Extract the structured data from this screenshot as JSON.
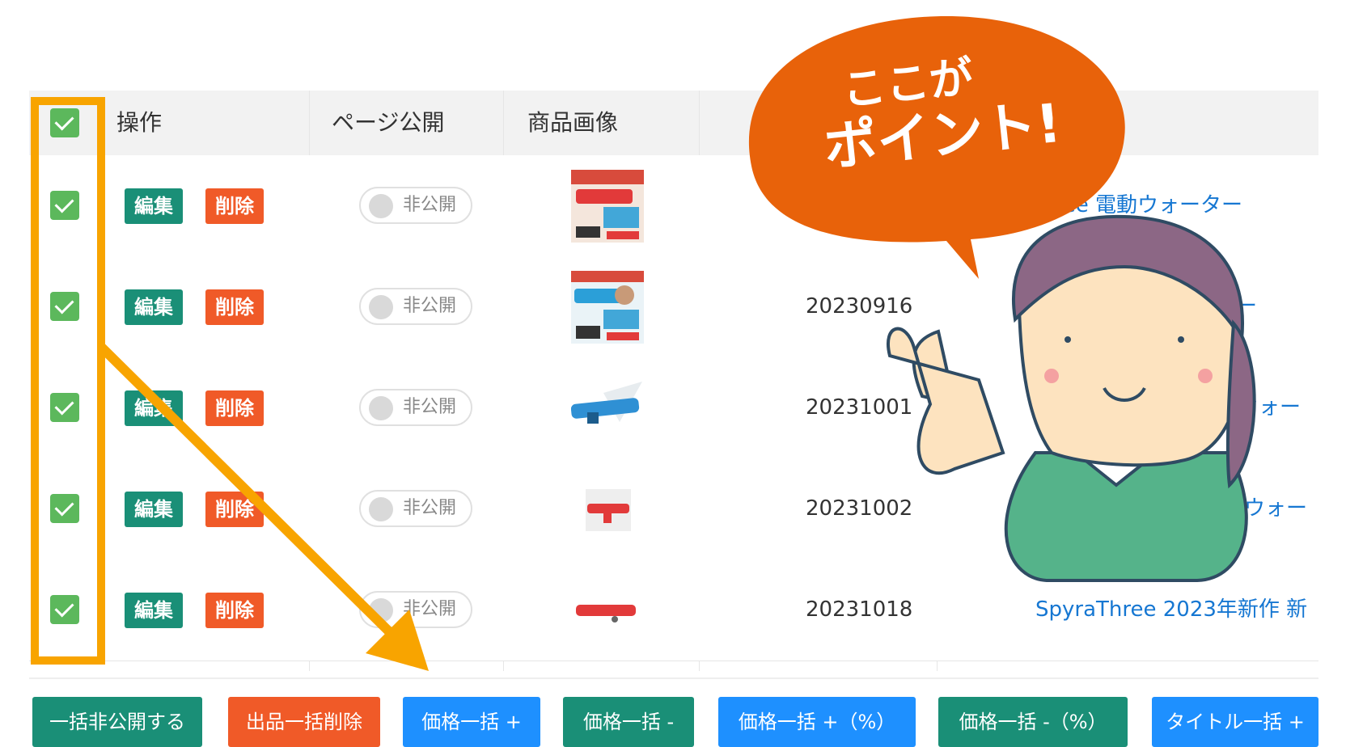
{
  "table": {
    "headers": {
      "operations": "操作",
      "page_publish": "ページ公開",
      "product_image": "商品画像"
    },
    "rows": [
      {
        "checked": true,
        "edit": "編集",
        "delete": "削除",
        "publish": "非公開",
        "code": "",
        "title": "Spyra Three 電動ウォーター"
      },
      {
        "checked": true,
        "edit": "編集",
        "delete": "削除",
        "publish": "非公開",
        "code": "20230916",
        "title": "ーター"
      },
      {
        "checked": true,
        "edit": "編集",
        "delete": "削除",
        "publish": "非公開",
        "code": "20231001",
        "title": "のウォー"
      },
      {
        "checked": true,
        "edit": "編集",
        "delete": "削除",
        "publish": "非公開",
        "code": "20231002",
        "title": "代のウォー"
      },
      {
        "checked": true,
        "edit": "編集",
        "delete": "削除",
        "publish": "非公開",
        "code": "20231018",
        "title": "SpyraThree 2023年新作 新"
      }
    ]
  },
  "footer_buttons": [
    {
      "label": "一括非公開する",
      "color": "#1a8f77"
    },
    {
      "label": "出品一括削除",
      "color": "#f05a28"
    },
    {
      "label": "価格一括 +",
      "color": "#1e90ff"
    },
    {
      "label": "価格一括 -",
      "color": "#1a8f77"
    },
    {
      "label": "価格一括 +（%）",
      "color": "#1e90ff"
    },
    {
      "label": "価格一括 -（%）",
      "color": "#1a8f77"
    },
    {
      "label": "タイトル一括 +",
      "color": "#1e90ff"
    }
  ],
  "callout": {
    "text_line1": "ここが",
    "text_line2": "ポイント!"
  },
  "colors": {
    "highlight": "#f8a400",
    "bubble": "#e8620a",
    "link": "#1677d2"
  }
}
